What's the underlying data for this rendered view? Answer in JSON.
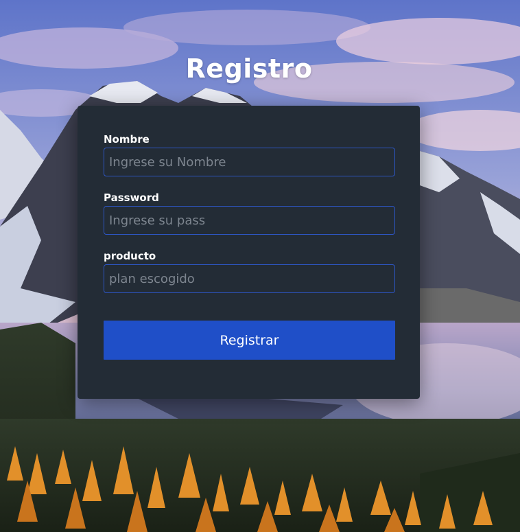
{
  "page": {
    "title": "Registro"
  },
  "form": {
    "fields": [
      {
        "label": "Nombre",
        "placeholder": "Ingrese su Nombre",
        "value": ""
      },
      {
        "label": "Password",
        "placeholder": "Ingrese su pass",
        "value": ""
      },
      {
        "label": "producto",
        "placeholder": "plan escogido",
        "value": ""
      }
    ],
    "submit_label": "Registrar"
  },
  "colors": {
    "card_background": "#232c36",
    "input_border": "#2d56c4",
    "button": "#1f4fc8",
    "title_text": "#ffffff"
  }
}
